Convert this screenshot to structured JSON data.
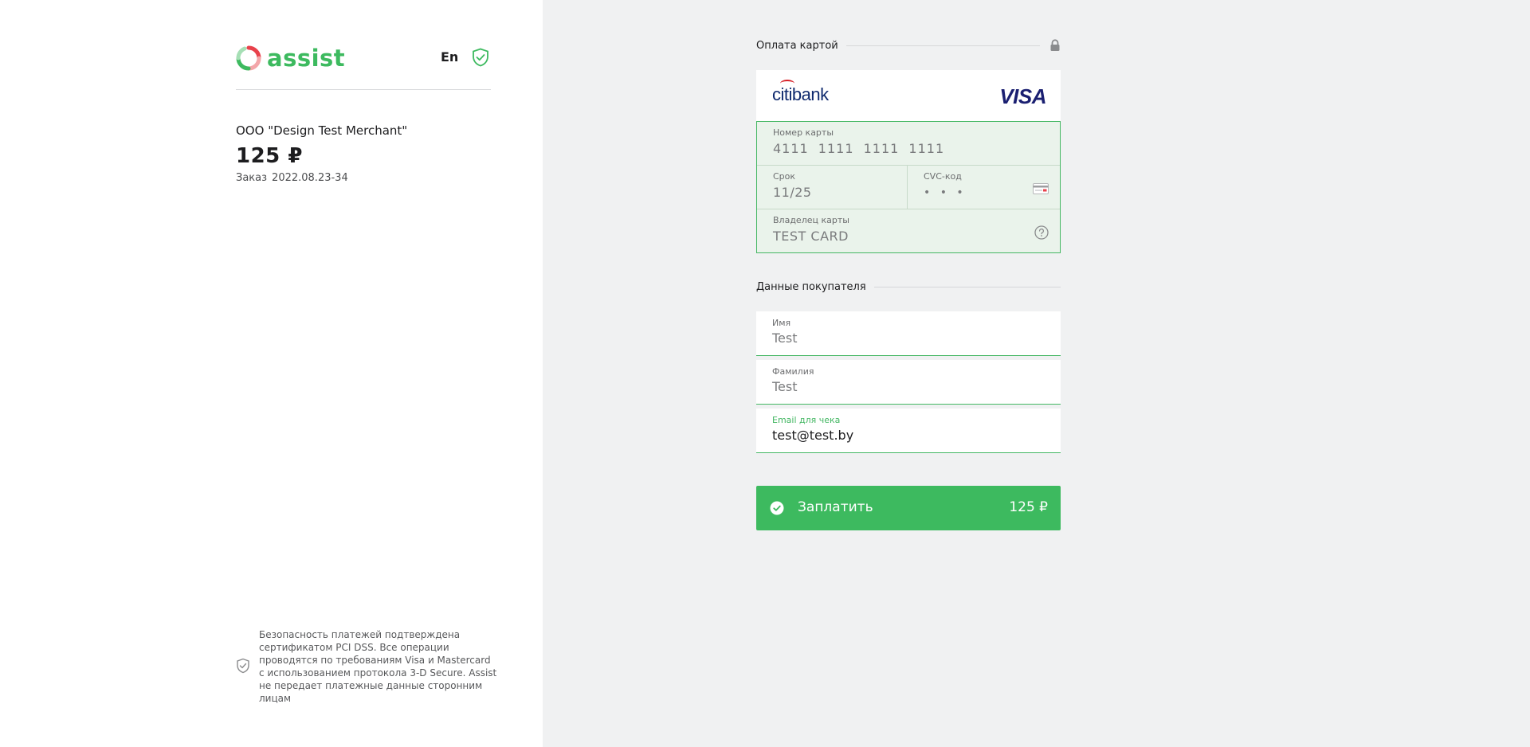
{
  "brand": {
    "name": "assist",
    "accent": "#3dba5f"
  },
  "header": {
    "language": "En"
  },
  "order": {
    "merchant": "ООО \"Design Test Merchant\"",
    "amount": "125 ₽",
    "order_label": "Заказ",
    "order_number": "2022.08.23-34"
  },
  "security_note": "Безопасность платежей подтверждена сертификатом PCI DSS. Все операции проводятся по требованиям Visa и Mastercard с использованием протокола 3-D Secure. Assist не передает платежные данные сторонним лицам",
  "card_section": {
    "title": "Оплата картой",
    "bank": "citibank",
    "network": "VISA",
    "card_number_label": "Номер карты",
    "card_number": "4111 1111 1111 1111",
    "expiry_label": "Срок",
    "expiry": "11/25",
    "cvc_label": "CVC-код",
    "cvc": "• • •",
    "holder_label": "Владелец карты",
    "holder": "TEST CARD"
  },
  "buyer_section": {
    "title": "Данные покупателя",
    "first_name_label": "Имя",
    "first_name": "Test",
    "last_name_label": "Фамилия",
    "last_name": "Test",
    "email_label": "Email для чека",
    "email": "test@test.by"
  },
  "pay_button": {
    "label": "Заплатить",
    "amount": "125 ₽"
  },
  "colors": {
    "accent": "#3dba5f",
    "field_bg": "#eaf3eb",
    "panel_bg": "#f0f1f2"
  }
}
